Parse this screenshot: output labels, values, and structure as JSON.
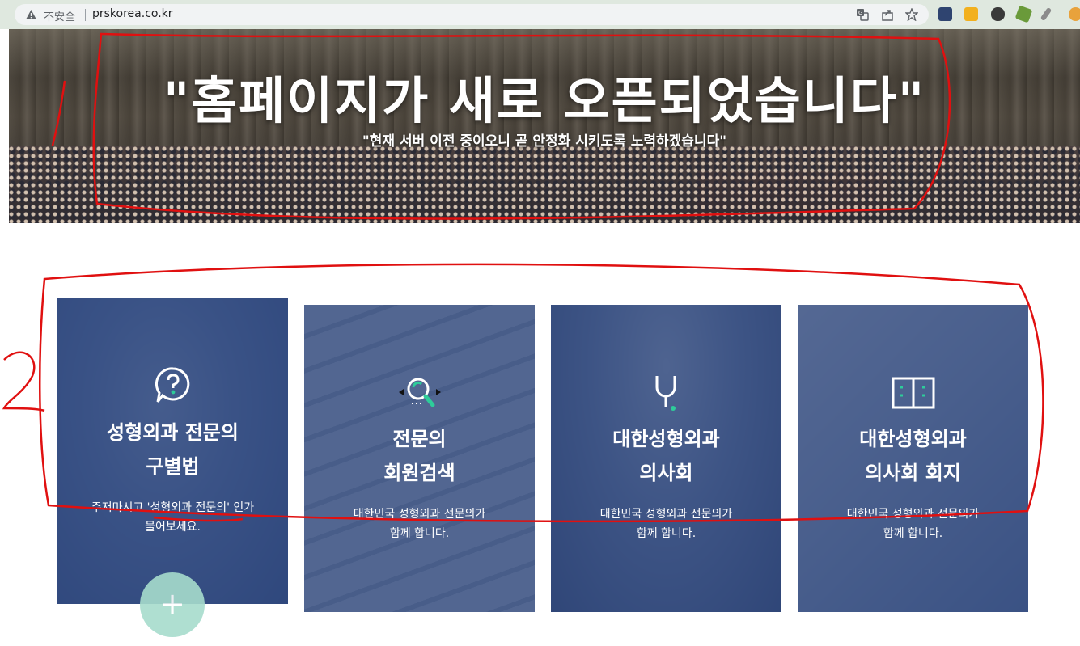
{
  "browser": {
    "security_label": "不安全",
    "url": "prskorea.co.kr",
    "icons": [
      "translate-icon",
      "share-icon",
      "bookmark-star-icon"
    ],
    "extensions": [
      "folder-extension-icon",
      "notes-extension-icon",
      "mask-extension-icon",
      "puzzle-extension-icon",
      "brush-extension-icon",
      "sale-extension-icon"
    ]
  },
  "hero": {
    "title": "\"홈페이지가 새로 오픈되었습니다\"",
    "subtitle": "\"현재 서버 이전 중이오니 곧 안정화 시키도록 노력하겠습니다\""
  },
  "cards": [
    {
      "icon": "speech-question-icon",
      "title_line1": "성형외과 전문의",
      "title_line2": "구별법",
      "desc_line1": "주저마시고 '성형외과 전문의' 인가",
      "desc_line2": "물어보세요."
    },
    {
      "icon": "search-member-icon",
      "title_line1": "전문의",
      "title_line2": "회원검색",
      "desc_line1": "대한민국 성형외과 전문의가",
      "desc_line2": "함께 합니다."
    },
    {
      "icon": "stethoscope-icon",
      "title_line1": "대한성형외과",
      "title_line2": "의사회",
      "desc_line1": "대한민국 성형외과 전문의가",
      "desc_line2": "함께 합니다."
    },
    {
      "icon": "open-book-icon",
      "title_line1": "대한성형외과",
      "title_line2": "의사회 회지",
      "desc_line1": "대한민국 성형외과 전문의가",
      "desc_line2": "함께 합니다."
    }
  ],
  "fab": {
    "label": "+"
  },
  "colors": {
    "card_overlay": "#2c447a",
    "accent_green": "#2ecc9a",
    "annotation_red": "#e01010"
  }
}
